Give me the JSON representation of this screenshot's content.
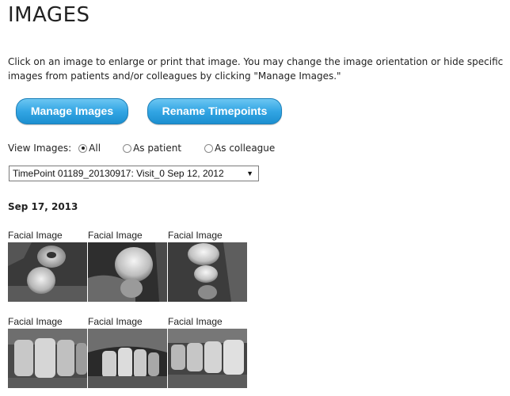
{
  "page": {
    "title": "IMAGES",
    "intro": "Click on an image to enlarge or print that image.  You may change the image orientation or hide specific images from patients and/or colleagues by clicking \"Manage Images.\""
  },
  "buttons": {
    "manage_images": "Manage Images",
    "rename_timepoints": "Rename Timepoints"
  },
  "view_images": {
    "label": "View Images:",
    "options": [
      "All",
      "As patient",
      "As colleague"
    ],
    "selected": "All"
  },
  "timepoint_select": {
    "value": "TimePoint 01189_20130917: Visit_0 Sep 12, 2012",
    "caret": "▼"
  },
  "section": {
    "date": "Sep 17, 2013",
    "images": [
      {
        "label": "Facial Image",
        "subject": "molar-crown-occlusal"
      },
      {
        "label": "Facial Image",
        "subject": "molar-crown-side"
      },
      {
        "label": "Facial Image",
        "subject": "molar-crown-top"
      },
      {
        "label": "Facial Image",
        "subject": "incisors-front"
      },
      {
        "label": "Facial Image",
        "subject": "incisors-lower"
      },
      {
        "label": "Facial Image",
        "subject": "teeth-side"
      }
    ]
  },
  "colors": {
    "button_top": "#6cc6f2",
    "button_bottom": "#1c8fd0",
    "text": "#222222"
  }
}
